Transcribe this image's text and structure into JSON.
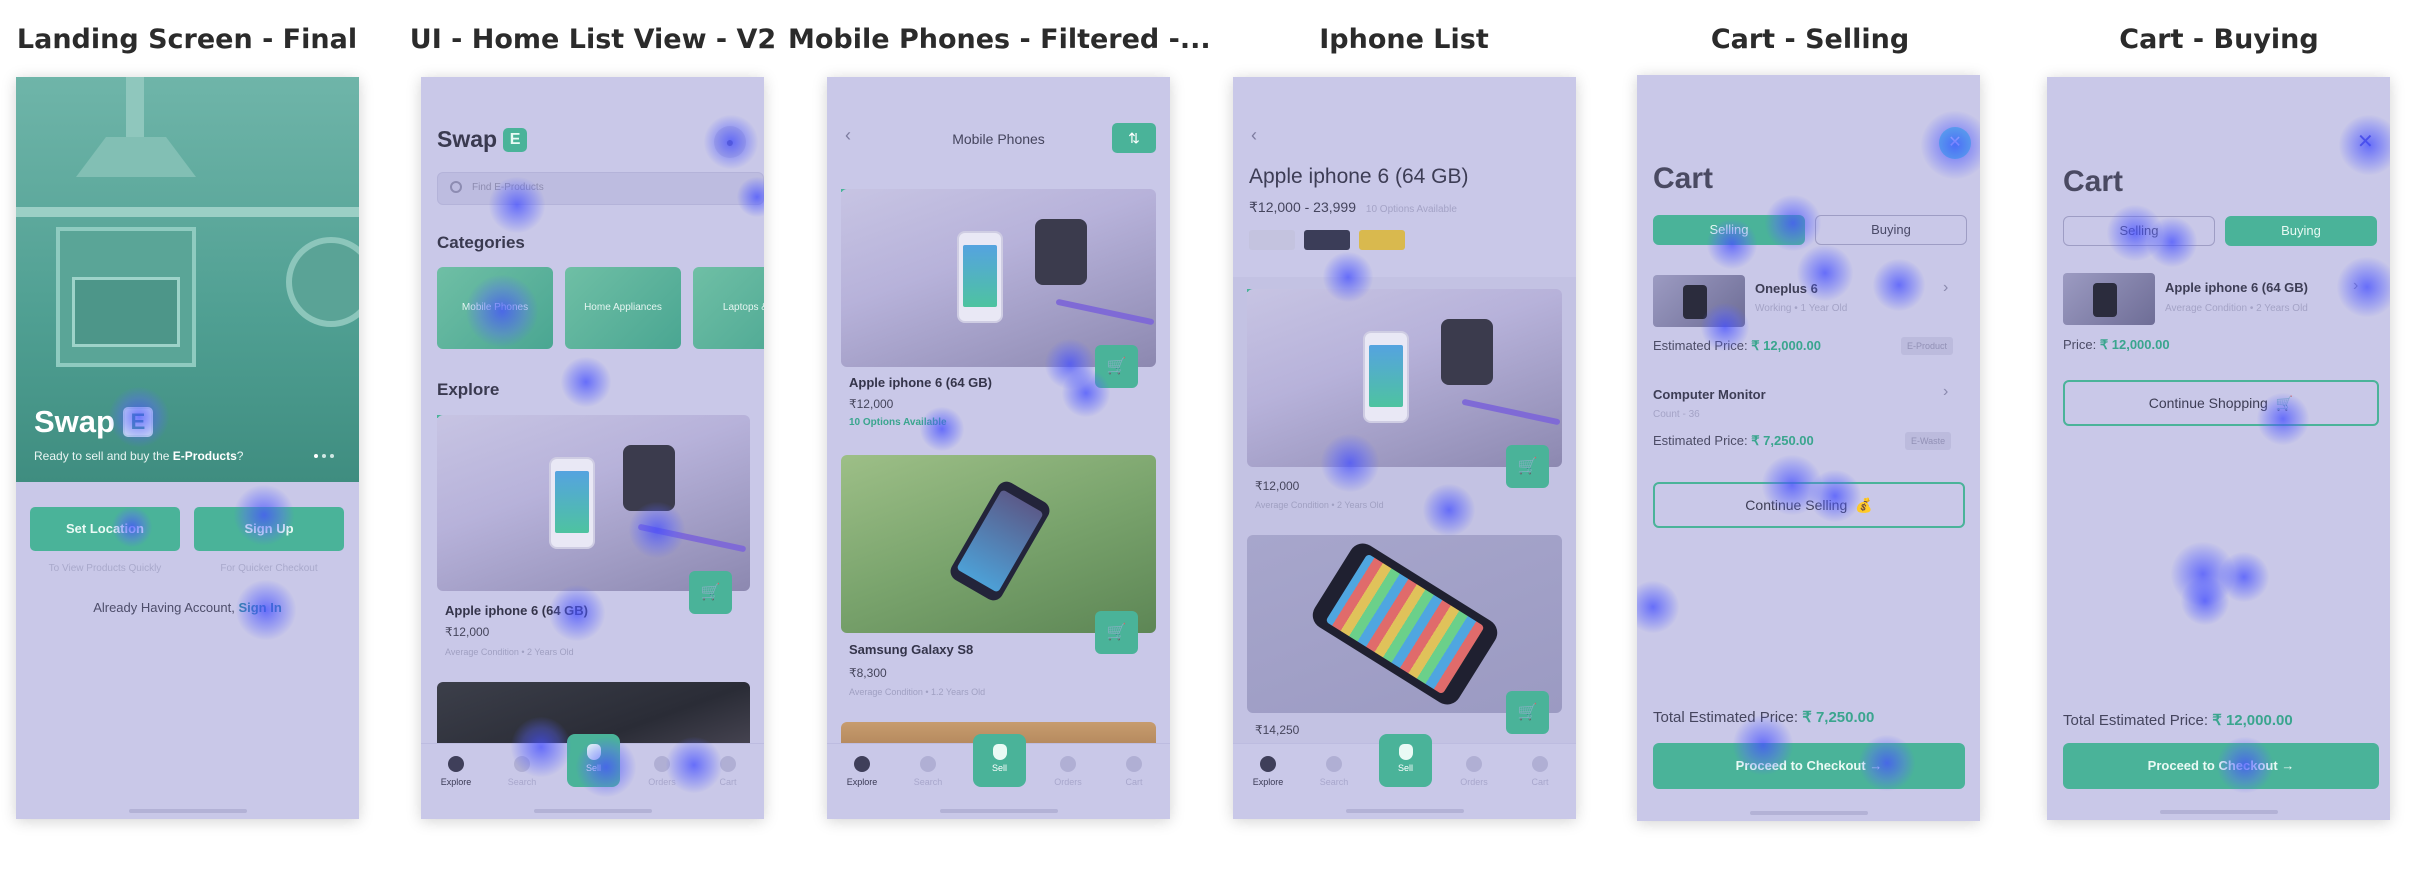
{
  "titles": [
    "Landing Screen - Final",
    "UI - Home List View - V2",
    "Mobile Phones - Filtered -...",
    "Iphone List",
    "Cart - Selling",
    "Cart - Buying"
  ],
  "landing": {
    "brand": "Swap",
    "brand_badge": "E",
    "tagline_prefix": "Ready to sell and buy the ",
    "tagline_bold": "E-Products",
    "tagline_suffix": "?",
    "set_location": "Set Location",
    "sign_up": "Sign Up",
    "hint_left": "To View Products Quickly",
    "hint_right": "For Quicker Checkout",
    "already": "Already Having Account,",
    "sign_in": "Sign In"
  },
  "home": {
    "brand": "Swap",
    "brand_badge": "E",
    "search_placeholder": "Find E-Products",
    "categories_heading": "Categories",
    "categories": [
      "Mobile Phones",
      "Home Appliances",
      "Laptops & ..."
    ],
    "explore_heading": "Explore",
    "product": {
      "name": "Apple iphone 6 (64 GB)",
      "price": "₹12,000",
      "sub": "Average Condition • 2 Years Old"
    }
  },
  "filtered": {
    "title": "Mobile Phones",
    "products": [
      {
        "name": "Apple iphone 6 (64 GB)",
        "price": "₹12,000",
        "options": "10 Options Available"
      },
      {
        "name": "Samsung Galaxy S8",
        "price": "₹8,300",
        "sub": "Average Condition • 1.2 Years Old"
      }
    ]
  },
  "iphone_list": {
    "title": "Apple iphone 6 (64 GB)",
    "price_range": "₹12,000 - 23,999",
    "options": "10 Options Available",
    "swatches": [
      "#c4c3df",
      "#3b3d58",
      "#d9b94e"
    ],
    "listings": [
      {
        "price": "₹12,000",
        "sub": "Average Condition • 2 Years Old"
      },
      {
        "price": "₹14,250"
      }
    ]
  },
  "tabs": [
    "Explore",
    "Search",
    "Sell",
    "Orders",
    "Cart"
  ],
  "cart_selling": {
    "title": "Cart",
    "seg_selling": "Selling",
    "seg_buying": "Buying",
    "items": [
      {
        "name": "Oneplus 6",
        "sub": "Working • 1 Year Old",
        "est_label": "Estimated Price:",
        "est_value": "₹ 12,000.00",
        "tag": "E-Product"
      },
      {
        "name": "Computer Monitor",
        "sub": "Count - 36",
        "est_label": "Estimated Price:",
        "est_value": "₹ 7,250.00",
        "tag": "E-Waste"
      }
    ],
    "continue": "Continue Selling",
    "total_label": "Total Estimated Price:",
    "total_value": "₹ 7,250.00",
    "checkout": "Proceed to Checkout"
  },
  "cart_buying": {
    "title": "Cart",
    "seg_selling": "Selling",
    "seg_buying": "Buying",
    "item": {
      "name": "Apple iphone 6 (64 GB)",
      "sub": "Average Condition • 2 Years Old",
      "price_label": "Price:",
      "price_value": "₹ 12,000.00"
    },
    "continue": "Continue Shopping",
    "total_label": "Total Estimated Price:",
    "total_value": "₹ 12,000.00",
    "checkout": "Proceed to Checkout"
  },
  "colors": {
    "accent": "#4ab399",
    "overlay": "#c9c8e8",
    "heat": "#4650ff"
  },
  "icons": [
    "user-icon",
    "search-icon",
    "cart-icon",
    "back-chevron-icon",
    "filter-icon",
    "close-icon",
    "money-bag-icon",
    "arrow-right-icon",
    "explore-icon",
    "orders-icon",
    "sell-icon"
  ]
}
